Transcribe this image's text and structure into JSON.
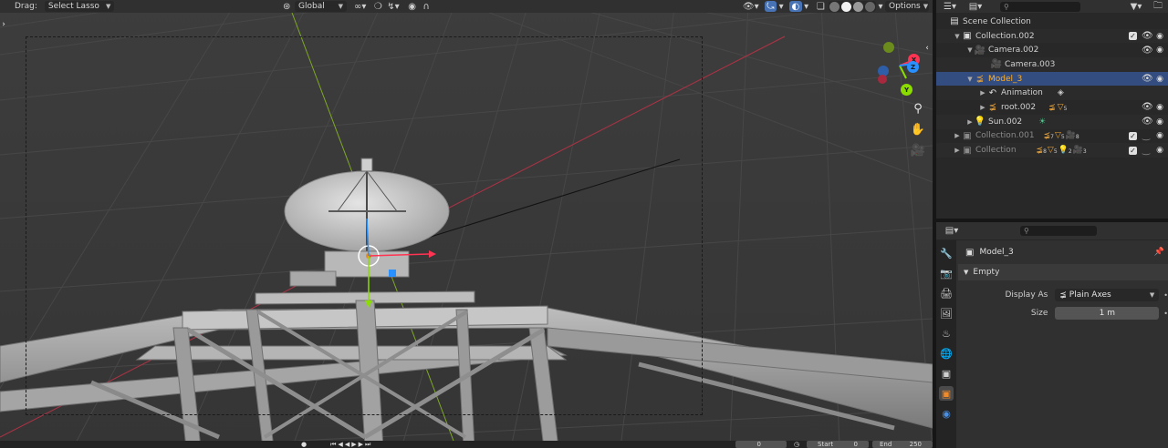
{
  "viewport_header": {
    "drag_label": "Drag:",
    "drag_mode": "Select Lasso",
    "orientation": "Global",
    "options_label": "Options"
  },
  "outliner": {
    "search_placeholder": "",
    "rows": [
      {
        "label": "Scene Collection"
      },
      {
        "label": "Collection.002"
      },
      {
        "label": "Camera.002"
      },
      {
        "label": "Camera.003"
      },
      {
        "label": "Model_3"
      },
      {
        "label": "Animation"
      },
      {
        "label": "root.002",
        "child_counts": [
          "5"
        ]
      },
      {
        "label": "Sun.002"
      },
      {
        "label": "Collection.001",
        "child_counts": [
          "7",
          "5",
          "8"
        ]
      },
      {
        "label": "Collection",
        "child_counts": [
          "8",
          "5",
          "2",
          "3"
        ]
      }
    ]
  },
  "properties": {
    "search_placeholder": "",
    "object_name": "Model_3",
    "panel_title": "Empty",
    "display_as_label": "Display As",
    "display_as_value": "Plain Axes",
    "size_label": "Size",
    "size_value": "1 m"
  },
  "timeline": {
    "current_frame": "0",
    "start_label": "Start",
    "start_value": "0",
    "end_label": "End",
    "end_value": "250"
  },
  "gizmo": {
    "x_label": "X",
    "y_label": "Y",
    "z_label": "Z"
  },
  "colors": {
    "selection_blue": "#334d80",
    "accent_blue": "#4772b3",
    "axis_x": "#ff3352",
    "axis_y": "#8bdc00",
    "axis_z": "#2890ff"
  }
}
